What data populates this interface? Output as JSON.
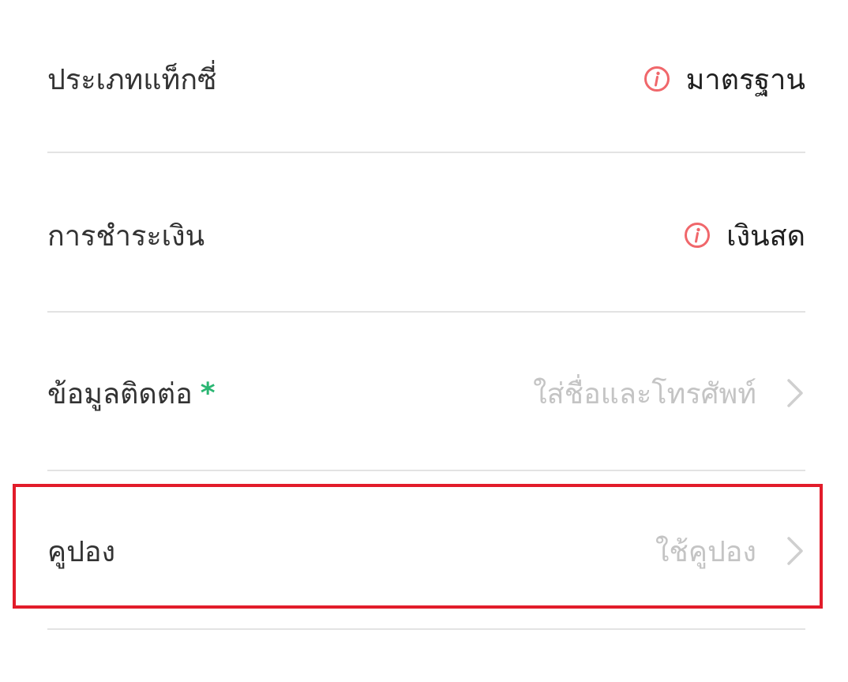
{
  "rows": {
    "taxi_type": {
      "label": "ประเภทแท็กซี่",
      "value": "มาตรฐาน",
      "icon": "info-icon"
    },
    "payment": {
      "label": "การชำระเงิน",
      "value": "เงินสด",
      "icon": "info-icon"
    },
    "contact": {
      "label": "ข้อมูลติดต่อ",
      "required_marker": "*",
      "placeholder": "ใส่ชื่อและโทรศัพท์",
      "icon": "chevron-right-icon"
    },
    "coupon": {
      "label": "คูปอง",
      "placeholder": "ใช้คูปอง",
      "icon": "chevron-right-icon"
    }
  },
  "colors": {
    "info_icon": "#f0676b",
    "required_marker": "#2bb673",
    "highlight_border": "#e21c2a",
    "placeholder": "#c4c4c4",
    "divider": "#e3e3e3"
  }
}
